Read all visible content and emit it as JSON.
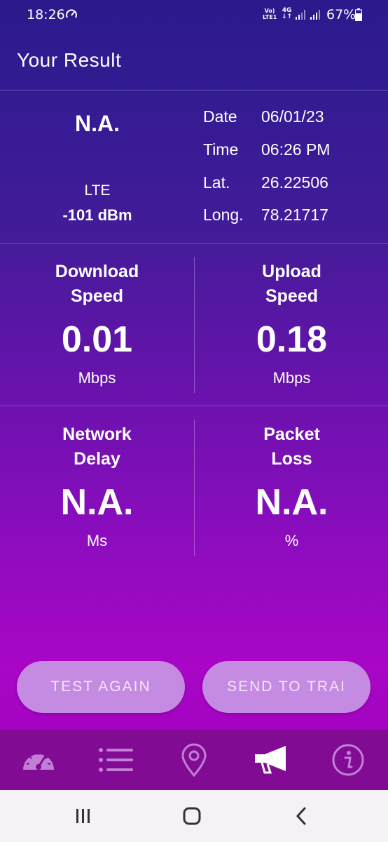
{
  "status_bar": {
    "time": "18:26",
    "volte_top": "Vo)",
    "volte_bottom": "LTE1",
    "net_top": "4G",
    "net_bottom": "↓↑",
    "battery": "67%"
  },
  "header": {
    "title": "Your Result"
  },
  "network": {
    "operator": "N.A.",
    "type": "LTE",
    "signal": "-101 dBm"
  },
  "info": {
    "date_label": "Date",
    "date_value": "06/01/23",
    "time_label": "Time",
    "time_value": "06:26 PM",
    "lat_label": "Lat.",
    "lat_value": "26.22506",
    "long_label": "Long.",
    "long_value": "78.21717"
  },
  "metrics": {
    "download": {
      "label_1": "Download",
      "label_2": "Speed",
      "value": "0.01",
      "unit": "Mbps"
    },
    "upload": {
      "label_1": "Upload",
      "label_2": "Speed",
      "value": "0.18",
      "unit": "Mbps"
    },
    "delay": {
      "label_1": "Network",
      "label_2": "Delay",
      "value": "N.A.",
      "unit": "Ms"
    },
    "loss": {
      "label_1": "Packet",
      "label_2": "Loss",
      "value": "N.A.",
      "unit": "%"
    }
  },
  "buttons": {
    "test_again": "TEST AGAIN",
    "send": "SEND TO TRAI"
  },
  "bottom_nav": [
    "speedometer-icon",
    "list-icon",
    "location-pin-icon",
    "megaphone-icon",
    "info-icon"
  ],
  "colors": {
    "button_bg": "#c58be2",
    "nav_bg": "#810c93",
    "header_bg": "#2b1a8c"
  }
}
